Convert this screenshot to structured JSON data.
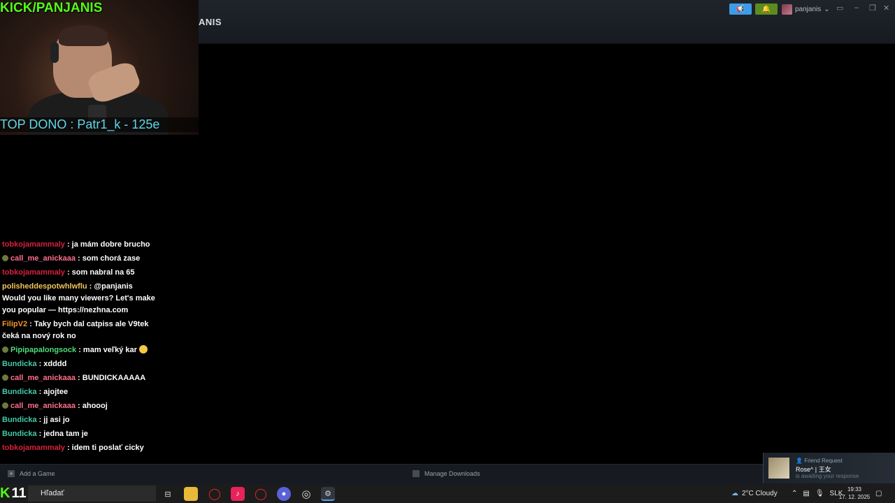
{
  "header": {
    "partial_title": "ANIS",
    "announce_icon": "megaphone-icon",
    "notify_icon": "bell-icon",
    "username": "panjanis",
    "accent_blue": "#3d9ce8",
    "accent_green": "#5c8c1d"
  },
  "overlay": {
    "kick_handle": "KICK/PANJANIS",
    "top_dono": "TOP DONO : Patr1_k - 125e"
  },
  "chat": {
    "messages": [
      {
        "user": "tobkojamammaly",
        "text": ": ja mám dobre brucho"
      },
      {
        "user": "call_me_anickaaa",
        "text": ": som chorá zase"
      },
      {
        "user": "tobkojamammaly",
        "text": ": som nabral na 65"
      },
      {
        "user": "polisheddespotwhlwflu",
        "text": ": @panjanis Would you like many viewers? Let's make you popular — https://nezhna.com"
      },
      {
        "user": "FilipV2",
        "text": ": Taky bych dal catpiss ale V9tek čeká na nový rok no"
      },
      {
        "user": "Pipipapalongsock",
        "text": ": mam veľký kar"
      },
      {
        "user": "Bundicka",
        "text": ": xdddd"
      },
      {
        "user": "call_me_anickaaa",
        "text": ": BUNDICKAAAAA"
      },
      {
        "user": "Bundicka",
        "text": ": ajojtee"
      },
      {
        "user": "call_me_anickaaa",
        "text": ": ahoooj"
      },
      {
        "user": "Bundicka",
        "text": ": jj asi jo"
      },
      {
        "user": "Bundicka",
        "text": ": jedna tam je"
      },
      {
        "user": "tobkojamammaly",
        "text": ": idem ti poslať cicky"
      }
    ]
  },
  "footer": {
    "add_game": "Add a Game",
    "manage_downloads": "Manage Downloads"
  },
  "friend_request": {
    "heading": "Friend Request",
    "name": "Rose^ | 王女",
    "status": "is awaiting your response"
  },
  "taskbar": {
    "kick_logo": "K",
    "number": "11",
    "search_placeholder": "Hľadať",
    "weather": "2°C  Cloudy",
    "lang": "SLK",
    "time": "19:33",
    "date": "17. 12. 2025"
  }
}
